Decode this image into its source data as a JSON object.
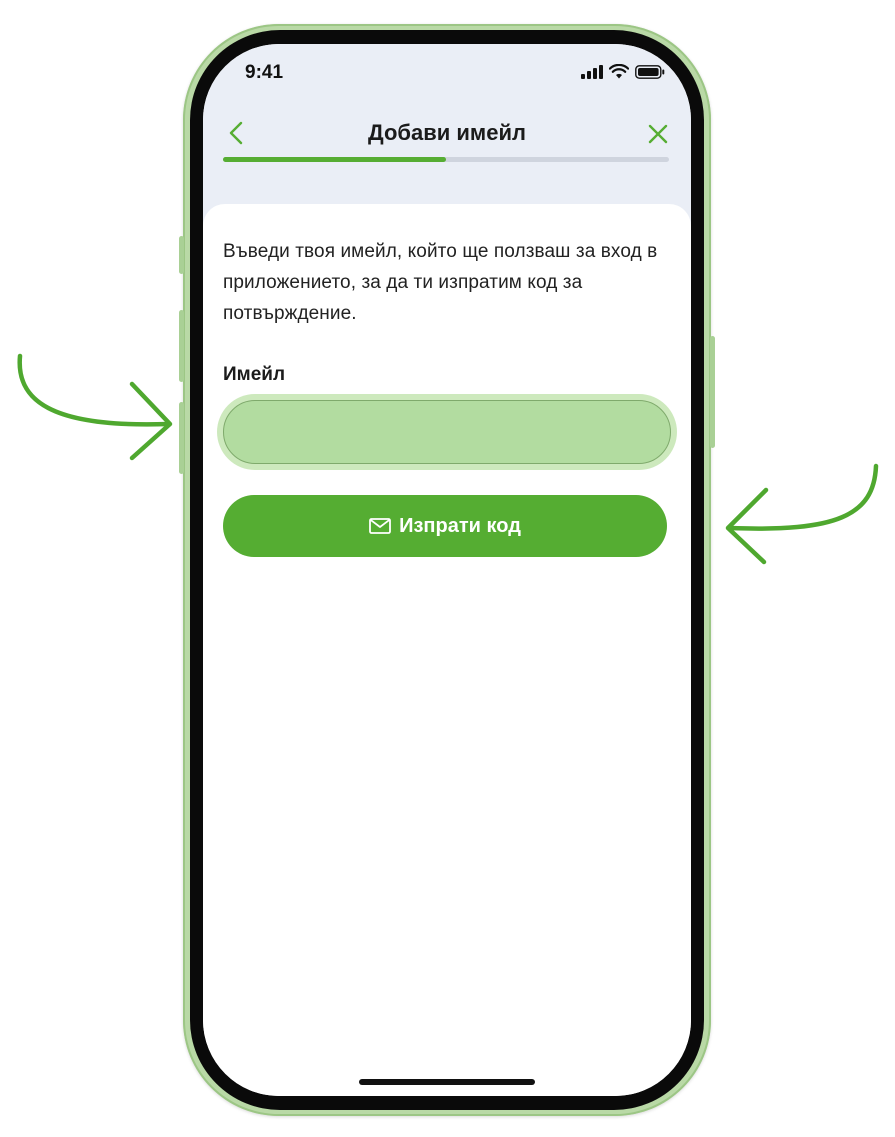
{
  "status_bar": {
    "time": "9:41",
    "icons": [
      "signal-icon",
      "wifi-icon",
      "battery-icon"
    ]
  },
  "nav": {
    "title": "Добави имейл",
    "back_icon": "chevron-left-icon",
    "close_icon": "close-icon"
  },
  "progress": {
    "value": 0.5
  },
  "description": "Въведи твоя имейл, който ще ползваш за вход в приложението, за да ти изпратим код за потвърждение.",
  "email": {
    "label": "Имейл",
    "value": "",
    "placeholder": ""
  },
  "send_button": {
    "label": "Изпрати код",
    "icon": "envelope-icon"
  },
  "annotations": {
    "arrow_icon": "hand-drawn-arrow-icon",
    "color": "#4fa82f"
  },
  "colors": {
    "accent": "#55ad32",
    "header_bg": "#eaeef6",
    "input_highlight": "#b2dca0",
    "frame": "#b9d9a6"
  }
}
